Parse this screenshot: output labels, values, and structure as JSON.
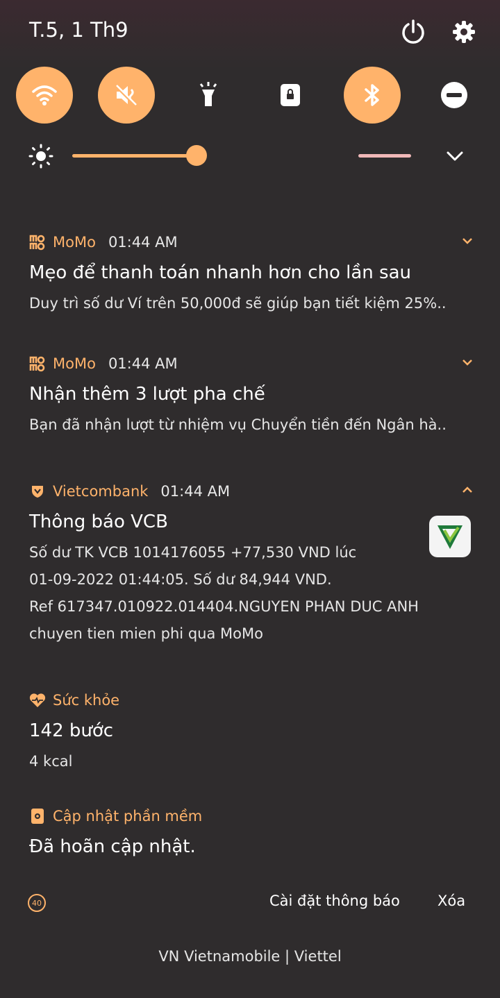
{
  "status": {
    "date": "T.5, 1 Th9"
  },
  "quick_settings": [
    {
      "name": "wifi",
      "active": true
    },
    {
      "name": "sound-muted",
      "active": true
    },
    {
      "name": "flashlight",
      "active": false
    },
    {
      "name": "lock-rotation",
      "active": false
    },
    {
      "name": "bluetooth",
      "active": true
    },
    {
      "name": "do-not-disturb",
      "active": false
    }
  ],
  "brightness": {
    "level": 0.47
  },
  "notifications": [
    {
      "app": "MoMo",
      "time": "01:44 AM",
      "title": "Mẹo để thanh toán nhanh hơn cho lần sau",
      "text": "Duy trì số dư Ví trên 50,000đ sẽ giúp bạn tiết kiệm 25%.."
    },
    {
      "app": "MoMo",
      "time": "01:44 AM",
      "title": "Nhận thêm 3 lượt pha chế",
      "text": "Bạn đã nhận lượt từ nhiệm vụ Chuyển tiền đến Ngân hà.."
    },
    {
      "app": "Vietcombank",
      "time": "01:44 AM",
      "title": "Thông báo VCB",
      "lines": [
        "Số dư TK VCB 1014176055 +77,530 VND lúc",
        "01-09-2022 01:44:05. Số dư 84,944 VND.",
        "Ref 617347.010922.014404.NGUYEN PHAN DUC ANH",
        "chuyen tien mien phi qua MoMo"
      ]
    },
    {
      "app": "Sức khỏe",
      "title": "142 bước",
      "text": "4 kcal"
    },
    {
      "app": "Cập nhật phần mềm",
      "title": "Đã hoãn cập nhật."
    }
  ],
  "footer": {
    "count": "40",
    "settings_label": "Cài đặt thông báo",
    "clear_label": "Xóa",
    "carrier": "VN Vietnamobile | Viettel"
  },
  "colors": {
    "accent": "#ffb36b",
    "background": "#2f2c2d"
  }
}
